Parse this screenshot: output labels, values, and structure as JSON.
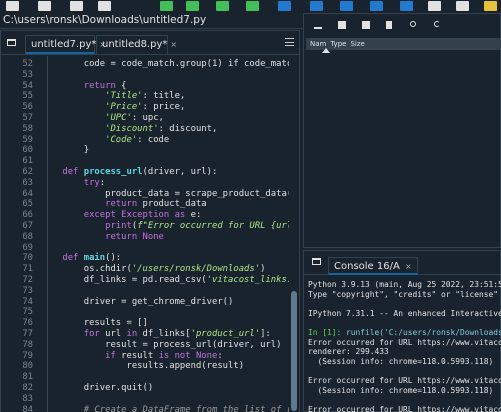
{
  "path": "C:\\users\\ronsk\\Downloads\\untitled7.py",
  "toolbar": {
    "icons": [
      "new-file-icon",
      "open-file-icon",
      "save-icon",
      "save-all-icon",
      "copy-icon",
      "run-icon",
      "run-cell-icon",
      "run-cell-advance-icon",
      "run-selection-icon",
      "step-icon",
      "debug-icon",
      "stop-icon",
      "maximize-icon",
      "preferences-icon",
      "python-path-icon"
    ]
  },
  "editor": {
    "tabs": [
      {
        "label": "untitled7.py*",
        "close": "×"
      },
      {
        "label": "untitled8.py*",
        "close": "×"
      }
    ],
    "lines": [
      {
        "n": "52",
        "parts": [
          [
            "",
            "        code = code_match.group(1) if code_match els"
          ]
        ]
      },
      {
        "n": "53",
        "parts": [
          [
            "",
            ""
          ]
        ]
      },
      {
        "n": "54",
        "parts": [
          [
            "k",
            "        return"
          ],
          [
            "",
            " {"
          ]
        ]
      },
      {
        "n": "55",
        "parts": [
          [
            "s",
            "            'Title'"
          ],
          [
            "",
            ": title,"
          ]
        ]
      },
      {
        "n": "56",
        "parts": [
          [
            "s",
            "            'Price'"
          ],
          [
            "",
            ": price,"
          ]
        ]
      },
      {
        "n": "57",
        "parts": [
          [
            "s",
            "            'UPC'"
          ],
          [
            "",
            ": upc,"
          ]
        ]
      },
      {
        "n": "58",
        "parts": [
          [
            "s",
            "            'Discount'"
          ],
          [
            "",
            ": discount,"
          ]
        ]
      },
      {
        "n": "59",
        "parts": [
          [
            "s",
            "            'Code'"
          ],
          [
            "",
            ": code"
          ]
        ]
      },
      {
        "n": "60",
        "parts": [
          [
            "",
            "        }"
          ]
        ]
      },
      {
        "n": "61",
        "parts": [
          [
            "",
            ""
          ]
        ]
      },
      {
        "n": "62",
        "parts": [
          [
            "k",
            "    def "
          ],
          [
            "fn",
            "process_url"
          ],
          [
            "",
            "(driver, url):"
          ]
        ]
      },
      {
        "n": "63",
        "parts": [
          [
            "k",
            "        try"
          ],
          [
            "",
            ":"
          ]
        ]
      },
      {
        "n": "64",
        "parts": [
          [
            "",
            "            product_data = scrape_product_data(drive"
          ]
        ]
      },
      {
        "n": "65",
        "parts": [
          [
            "k",
            "            return"
          ],
          [
            "",
            " product_data"
          ]
        ]
      },
      {
        "n": "66",
        "parts": [
          [
            "k",
            "        except"
          ],
          [
            "",
            " "
          ],
          [
            "bi",
            "Exception"
          ],
          [
            "",
            " "
          ],
          [
            "k",
            "as"
          ],
          [
            "",
            " e:"
          ]
        ]
      },
      {
        "n": "67",
        "parts": [
          [
            "bi",
            "            print"
          ],
          [
            "",
            "("
          ],
          [
            "s",
            "f\"Error occurred for URL {url}: {e"
          ]
        ]
      },
      {
        "n": "68",
        "parts": [
          [
            "k",
            "            return"
          ],
          [
            "",
            " "
          ],
          [
            "k",
            "None"
          ]
        ]
      },
      {
        "n": "69",
        "parts": [
          [
            "",
            ""
          ]
        ]
      },
      {
        "n": "70",
        "parts": [
          [
            "k",
            "    def "
          ],
          [
            "fn",
            "main"
          ],
          [
            "",
            "():"
          ]
        ]
      },
      {
        "n": "71",
        "parts": [
          [
            "",
            "        os.chdir("
          ],
          [
            "s",
            "'/users/ronsk/Downloads'"
          ],
          [
            "",
            ")"
          ]
        ]
      },
      {
        "n": "72",
        "parts": [
          [
            "",
            "        df_links = pd.read_csv("
          ],
          [
            "s",
            "'vitacost_links.csv'"
          ],
          [
            "",
            ","
          ]
        ]
      },
      {
        "n": "73",
        "parts": [
          [
            "",
            ""
          ]
        ]
      },
      {
        "n": "74",
        "parts": [
          [
            "",
            "        driver = get_chrome_driver()"
          ]
        ]
      },
      {
        "n": "75",
        "parts": [
          [
            "",
            ""
          ]
        ]
      },
      {
        "n": "76",
        "parts": [
          [
            "",
            "        results = []"
          ]
        ]
      },
      {
        "n": "77",
        "parts": [
          [
            "k",
            "        for"
          ],
          [
            "",
            " url "
          ],
          [
            "k",
            "in"
          ],
          [
            "",
            " df_links["
          ],
          [
            "s",
            "'product_url'"
          ],
          [
            "",
            "]:"
          ]
        ]
      },
      {
        "n": "78",
        "parts": [
          [
            "",
            "            result = process_url(driver, url)"
          ]
        ]
      },
      {
        "n": "79",
        "parts": [
          [
            "k",
            "            if"
          ],
          [
            "",
            " result "
          ],
          [
            "k",
            "is not"
          ],
          [
            "",
            " "
          ],
          [
            "k",
            "None"
          ],
          [
            "",
            ":"
          ]
        ]
      },
      {
        "n": "80",
        "parts": [
          [
            "",
            "                results.append(result)"
          ]
        ]
      },
      {
        "n": "81",
        "parts": [
          [
            "",
            ""
          ]
        ]
      },
      {
        "n": "82",
        "parts": [
          [
            "",
            "        driver.quit()"
          ]
        ]
      },
      {
        "n": "83",
        "parts": [
          [
            "",
            ""
          ]
        ]
      },
      {
        "n": "84",
        "parts": [
          [
            "cm",
            "        # Create a DataFrame from the list of result"
          ]
        ]
      }
    ]
  },
  "variables": {
    "columns": [
      "Nam",
      "Type",
      "Size"
    ]
  },
  "console": {
    "tab": "Console 16/A",
    "close": "×",
    "lines": [
      {
        "t": "",
        "text": "Python 3.9.13 (main, Aug 25 2022, 23:51:50)"
      },
      {
        "t": "",
        "text": "Type \"copyright\", \"credits\" or \"license\" for"
      },
      {
        "t": "",
        "text": ""
      },
      {
        "t": "",
        "text": "IPython 7.31.1 -- An enhanced Interactive Py"
      },
      {
        "t": "",
        "text": ""
      },
      {
        "t": "prompt",
        "prompt": "In [1]: ",
        "text": "runfile('C:/users/ronsk/Downloads/un"
      },
      {
        "t": "",
        "text": "Error occurred for URL https://www.vitacost."
      },
      {
        "t": "",
        "text": "renderer: 299.433"
      },
      {
        "t": "",
        "text": "  (Session info: chrome=118.0.5993.118)"
      },
      {
        "t": "",
        "text": ""
      },
      {
        "t": "",
        "text": "Error occurred for URL https://www.vitacost."
      },
      {
        "t": "",
        "text": "  (Session info: chrome=118.0.5993.118)"
      },
      {
        "t": "",
        "text": ""
      },
      {
        "t": "",
        "text": "Error occurred for URL https://www.vitacost."
      }
    ]
  }
}
